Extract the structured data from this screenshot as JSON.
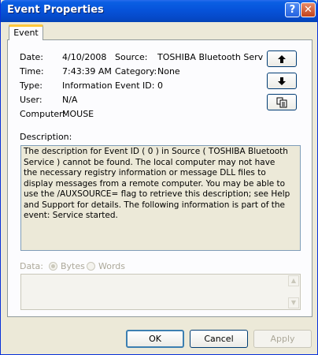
{
  "window": {
    "title": "Event Properties"
  },
  "titlebar": {
    "help_label": "?",
    "close_label": "✕"
  },
  "tabs": [
    {
      "label": "Event"
    }
  ],
  "event": {
    "date_label": "Date:",
    "date_value": "4/10/2008",
    "time_label": "Time:",
    "time_value": "7:43:39 AM",
    "type_label": "Type:",
    "type_value": "Information",
    "user_label": "User:",
    "user_value": "N/A",
    "computer_label": "Computer:",
    "computer_value": "MOUSE",
    "source_label": "Source:",
    "source_value": "TOSHIBA Bluetooth Serv",
    "category_label": "Category:",
    "category_value": "None",
    "eventid_label": "Event ID:",
    "eventid_value": "0"
  },
  "nav_buttons": {
    "up_icon": "arrow-up-icon",
    "down_icon": "arrow-down-icon",
    "copy_icon": "copy-icon"
  },
  "description": {
    "label": "Description:",
    "text": "The description for Event ID ( 0 ) in Source ( TOSHIBA Bluetooth Service ) cannot be found. The local computer may not have the necessary registry information or message DLL files to display messages from a remote computer. You may be able to use the /AUXSOURCE= flag to retrieve this description; see Help and Support for details. The following information is part of the event: Service started."
  },
  "data_section": {
    "label": "Data:",
    "bytes_label": "Bytes",
    "words_label": "Words",
    "selected": "Bytes"
  },
  "buttons": {
    "ok": "OK",
    "cancel": "Cancel",
    "apply": "Apply"
  }
}
